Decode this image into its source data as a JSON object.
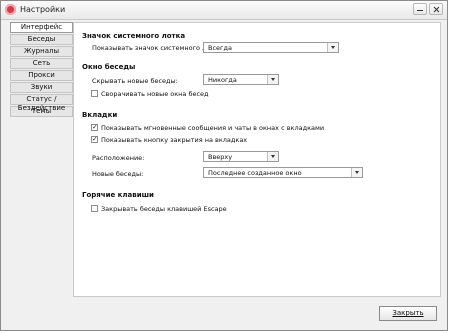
{
  "window": {
    "title": "Настройки"
  },
  "sidebar": {
    "items": [
      {
        "label": "Интерфейс"
      },
      {
        "label": "Беседы"
      },
      {
        "label": "Журналы"
      },
      {
        "label": "Сеть"
      },
      {
        "label": "Прокси"
      },
      {
        "label": "Звуки"
      },
      {
        "label": "Статус / Бездействие"
      },
      {
        "label": "Темы"
      }
    ]
  },
  "main": {
    "tray_title": "Значок системного лотка",
    "tray_label": "Показывать значок системного лотка:",
    "tray_value": "Всегда",
    "conv_title": "Окно беседы",
    "hide_label": "Скрывать новые беседы:",
    "hide_value": "Никогда",
    "minimize_label": "Сворачивать новые окна бесед",
    "tabs_title": "Вкладки",
    "tabs_cb1": "Показывать мгновенные сообщения и чаты в окнах с вкладками",
    "tabs_cb2": "Показывать кнопку закрытия на вкладках",
    "place_label": "Расположение:",
    "place_value": "Вверху",
    "new_label": "Новые беседы:",
    "new_value": "Последнее созданное окно",
    "hotkeys_title": "Горячие клавиши",
    "hotkeys_cb": "Закрывать беседы клавишей Escape"
  },
  "footer": {
    "close_label": "Закрыть"
  }
}
